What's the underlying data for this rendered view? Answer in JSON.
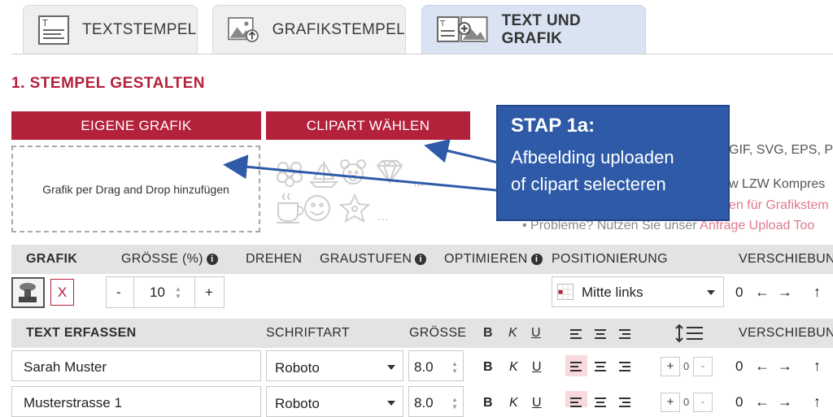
{
  "tabs": [
    {
      "label": "TEXTSTEMPEL",
      "icon": "text-stamp-icon",
      "active": false
    },
    {
      "label": "GRAFIKSTEMPEL",
      "icon": "image-upload-icon",
      "active": false
    },
    {
      "label": "TEXT UND GRAFIK",
      "icon": "text-image-icon",
      "active": true
    }
  ],
  "section_title": "1. STEMPEL GESTALTEN",
  "buttons": {
    "own_graphic": "EIGENE GRAFIK",
    "clipart": "CLIPART WÄHLEN"
  },
  "dropzone_text": "Grafik per Drag and Drop hinzufügen",
  "clipart_more": "...",
  "right_info": {
    "formats": "GIF, SVG, EPS, PD",
    "compression": "w LZW Kompres",
    "link": "en für Grafikstem",
    "problems_prefix": "Probleme? Nutzen Sie unser ",
    "problems_link": "Anfrage Upload Too"
  },
  "callout": {
    "title": "STAP 1a:",
    "line1": "Afbeelding uploaden",
    "line2": "of clipart selecteren"
  },
  "graphic_header": {
    "grafik": "GRAFIK",
    "groesse": "GRÖSSE (%)",
    "drehen": "DREHEN",
    "graustufen": "GRAUSTUFEN",
    "optimieren": "OPTIMIEREN",
    "positionierung": "POSITIONIERUNG",
    "verschiebung": "VERSCHIEBUNG"
  },
  "graphic_row": {
    "remove": "X",
    "minus": "-",
    "size_value": "10",
    "plus": "+",
    "position_value": "Mitte links",
    "shift_value": "0"
  },
  "text_header": {
    "text_erfassen": "TEXT ERFASSEN",
    "schriftart": "SCHRIFTART",
    "groesse": "GRÖSSE",
    "bold": "B",
    "italic": "K",
    "underline": "U",
    "verschiebung": "VERSCHIEBUNG"
  },
  "text_rows": [
    {
      "text": "Sarah Muster",
      "font": "Roboto",
      "size": "8.0",
      "bold": "B",
      "italic": "K",
      "underline": "U",
      "spacing_plus": "+",
      "spacing_value": "0",
      "spacing_minus": "-",
      "shift": "0"
    },
    {
      "text": "Musterstrasse 1",
      "font": "Roboto",
      "size": "8.0",
      "bold": "B",
      "italic": "K",
      "underline": "U",
      "spacing_plus": "+",
      "spacing_value": "0",
      "spacing_minus": "-",
      "shift": "0"
    }
  ],
  "colors": {
    "brand_red": "#b4213a",
    "callout_blue": "#2e5aa8",
    "active_tab": "#d9e3f2",
    "header_gray": "#e3e3e3"
  }
}
